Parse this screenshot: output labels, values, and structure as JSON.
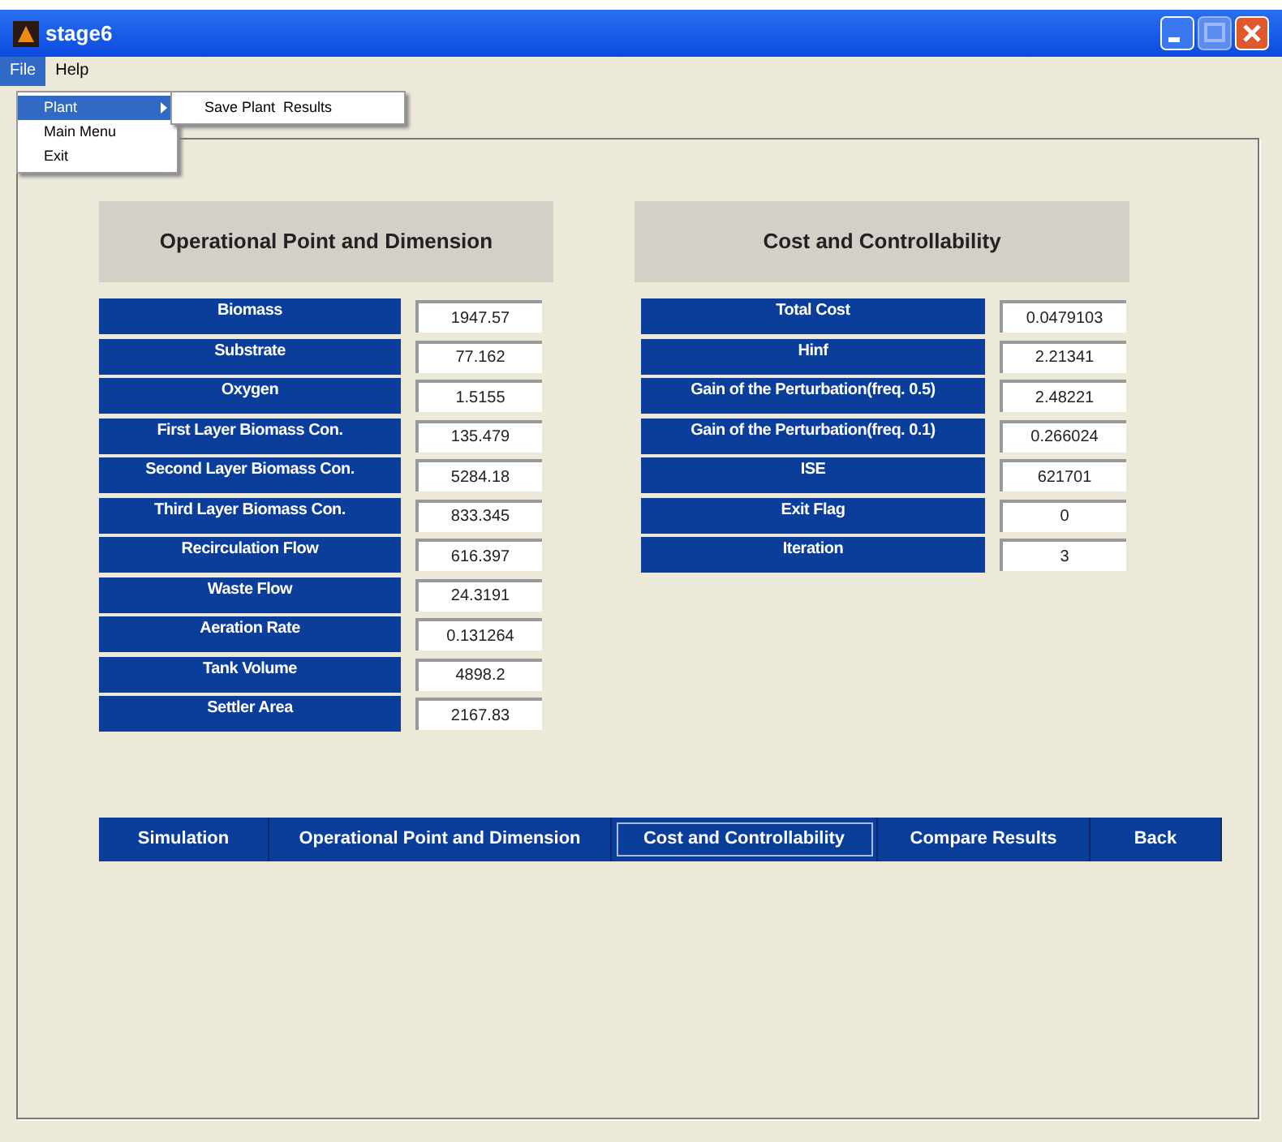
{
  "window": {
    "title": "stage6"
  },
  "menu_bar": [
    {
      "label": "File",
      "selected": true
    },
    {
      "label": "Help",
      "selected": false
    }
  ],
  "file_menu": [
    {
      "label": "Plant",
      "selected": true,
      "has_submenu": true
    },
    {
      "label": "Main Menu",
      "selected": false,
      "has_submenu": false
    },
    {
      "label": "Exit",
      "selected": false,
      "has_submenu": false
    }
  ],
  "submenu": [
    {
      "label": "Save Plant  Results"
    }
  ],
  "left_panel": {
    "title": "Operational Point  and Dimension",
    "rows": [
      {
        "label": "Biomass",
        "value": "1947.57"
      },
      {
        "label": "Substrate",
        "value": "77.162"
      },
      {
        "label": "Oxygen",
        "value": "1.5155"
      },
      {
        "label": "First Layer Biomass Con.",
        "value": "135.479"
      },
      {
        "label": "Second Layer Biomass Con.",
        "value": "5284.18"
      },
      {
        "label": "Third Layer Biomass Con.",
        "value": "833.345"
      },
      {
        "label": "Recirculation Flow",
        "value": "616.397"
      },
      {
        "label": "Waste Flow",
        "value": "24.3191"
      },
      {
        "label": "Aeration Rate",
        "value": "0.131264"
      },
      {
        "label": "Tank Volume",
        "value": "4898.2"
      },
      {
        "label": "Settler Area",
        "value": "2167.83"
      }
    ]
  },
  "right_panel": {
    "title": "Cost and Controllability",
    "rows": [
      {
        "label": "Total Cost",
        "value": "0.0479103"
      },
      {
        "label": "Hinf",
        "value": "2.21341"
      },
      {
        "label": "Gain of the Perturbation(freq. 0.5)",
        "value": "2.48221"
      },
      {
        "label": "Gain of the Perturbation(freq. 0.1)",
        "value": "0.266024"
      },
      {
        "label": "ISE",
        "value": "621701"
      },
      {
        "label": "Exit Flag",
        "value": "0"
      },
      {
        "label": "Iteration",
        "value": "3"
      }
    ]
  },
  "nav_buttons": [
    {
      "label": "Simulation",
      "selected": false
    },
    {
      "label": "Operational Point and Dimension",
      "selected": false
    },
    {
      "label": "Cost and Controllability",
      "selected": true
    },
    {
      "label": "Compare Results",
      "selected": false
    },
    {
      "label": "Back",
      "selected": false
    }
  ]
}
